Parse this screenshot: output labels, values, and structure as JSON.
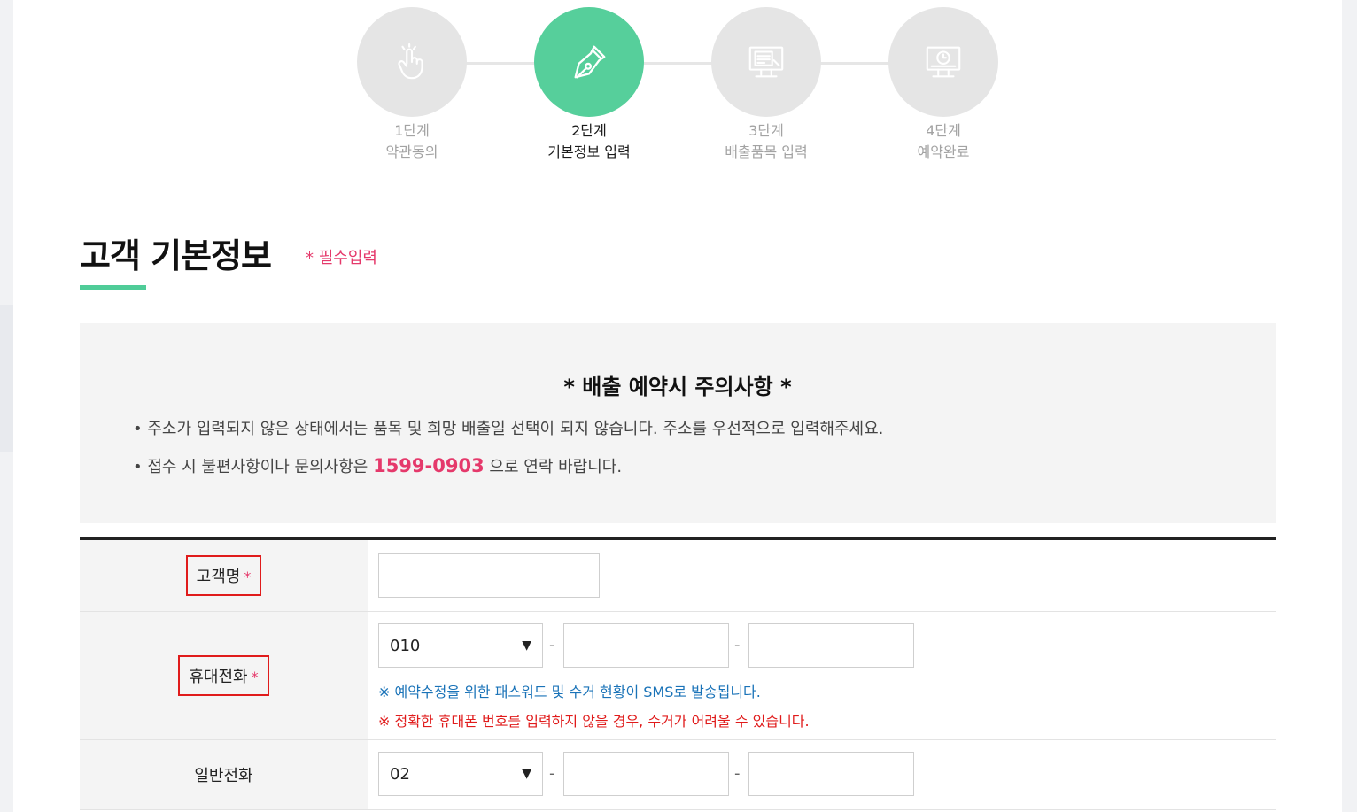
{
  "steps": [
    {
      "num": "1단계",
      "name": "약관동의",
      "icon": "hand-pointer-icon",
      "active": false
    },
    {
      "num": "2단계",
      "name": "기본정보 입력",
      "icon": "pen-nib-icon",
      "active": true
    },
    {
      "num": "3단계",
      "name": "배출품목 입력",
      "icon": "monitor-form-icon",
      "active": false
    },
    {
      "num": "4단계",
      "name": "예약완료",
      "icon": "monitor-clock-icon",
      "active": false
    }
  ],
  "section": {
    "title": "고객 기본정보",
    "required_note": "* 필수입력"
  },
  "notice": {
    "title": "*  배출 예약시 주의사항  *",
    "line1": "• 주소가 입력되지 않은 상태에서는 품목 및 희망 배출일 선택이 되지 않습니다. 주소를 우선적으로 입력해주세요.",
    "line2_prefix": "• 접수 시 불편사항이나 문의사항은 ",
    "phone": "1599-0903",
    "line2_suffix": " 으로 연락 바랍니다."
  },
  "form": {
    "name_label": "고객명",
    "name_value": "",
    "mobile_label": "휴대전화",
    "mobile_prefix": "010",
    "mobile_mid": "",
    "mobile_last": "",
    "mobile_hint_blue": "※ 예약수정을 위한 패스워드 및 수거 현황이 SMS로 발송됩니다.",
    "mobile_hint_red": "※ 정확한 휴대폰 번호를 입력하지 않을 경우, 수거가 어려울 수 있습니다.",
    "phone_label": "일반전화",
    "phone_prefix": "02",
    "phone_mid": "",
    "phone_last": "",
    "required_mark": "*",
    "dash": "-",
    "caret": "▼"
  },
  "colors": {
    "accent_green": "#56cf9b",
    "required_pink": "#e5396b",
    "hint_blue": "#1a73b8",
    "hint_red": "#e01b1b"
  }
}
